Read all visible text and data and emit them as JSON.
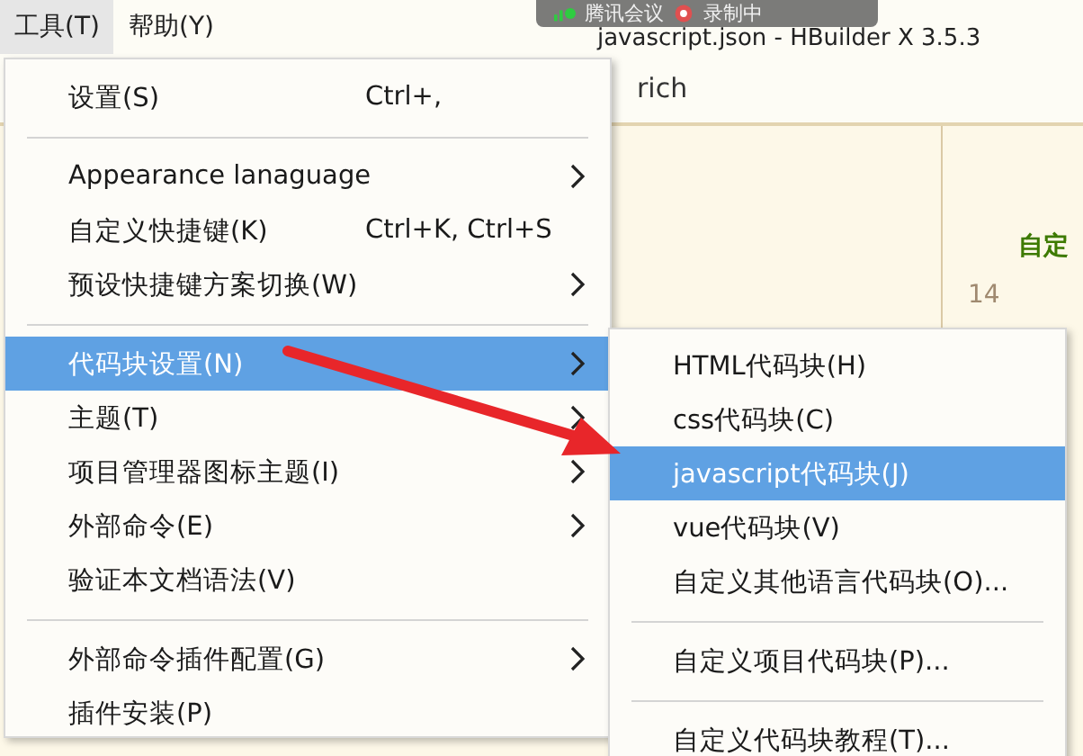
{
  "menubar": [
    {
      "label": "工具(T)",
      "selected": true
    },
    {
      "label": "帮助(Y)",
      "selected": false
    }
  ],
  "window": {
    "title": "javascript.json - HBuilder X 3.5.3"
  },
  "meeting_overlay": {
    "app": "腾讯会议",
    "recording": "录制中"
  },
  "editor": {
    "tab": "rich",
    "line_number": "14",
    "heading": "自定"
  },
  "menu": [
    {
      "kind": "item",
      "label": "设置(S)",
      "shortcut": "Ctrl+,",
      "submenu": false,
      "selected": false
    },
    {
      "kind": "separator"
    },
    {
      "kind": "item",
      "label": "Appearance lanaguage",
      "submenu": true,
      "selected": false
    },
    {
      "kind": "item",
      "label": "自定义快捷键(K)",
      "shortcut": "Ctrl+K, Ctrl+S",
      "submenu": false,
      "selected": false
    },
    {
      "kind": "item",
      "label": "预设快捷键方案切换(W)",
      "submenu": true,
      "selected": false
    },
    {
      "kind": "separator"
    },
    {
      "kind": "item",
      "label": "代码块设置(N)",
      "submenu": true,
      "selected": true
    },
    {
      "kind": "item",
      "label": "主题(T)",
      "submenu": true,
      "selected": false
    },
    {
      "kind": "item",
      "label": "项目管理器图标主题(I)",
      "submenu": true,
      "selected": false
    },
    {
      "kind": "item",
      "label": "外部命令(E)",
      "submenu": true,
      "selected": false
    },
    {
      "kind": "item",
      "label": "验证本文档语法(V)",
      "submenu": false,
      "selected": false
    },
    {
      "kind": "separator"
    },
    {
      "kind": "item",
      "label": "外部命令插件配置(G)",
      "submenu": true,
      "selected": false
    },
    {
      "kind": "item",
      "label": "插件安装(P)",
      "submenu": false,
      "selected": false
    }
  ],
  "submenu": [
    {
      "kind": "item",
      "label": "HTML代码块(H)",
      "selected": false
    },
    {
      "kind": "item",
      "label": "css代码块(C)",
      "selected": false
    },
    {
      "kind": "item",
      "label": "javascript代码块(J)",
      "selected": true
    },
    {
      "kind": "item",
      "label": "vue代码块(V)",
      "selected": false
    },
    {
      "kind": "item",
      "label": "自定义其他语言代码块(O)...",
      "selected": false
    },
    {
      "kind": "separator"
    },
    {
      "kind": "item",
      "label": "自定义项目代码块(P)...",
      "selected": false
    },
    {
      "kind": "separator"
    },
    {
      "kind": "item",
      "label": "自定义代码块教程(T)...",
      "selected": false
    }
  ]
}
